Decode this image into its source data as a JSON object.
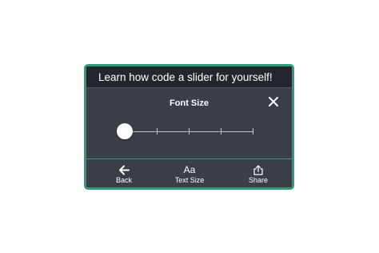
{
  "header": {
    "title": "Learn how code a slider for yourself!"
  },
  "panel": {
    "title": "Font Size",
    "close_icon": "close-icon"
  },
  "slider": {
    "tick_count": 5,
    "selected_index": 0,
    "value_fraction": 0
  },
  "footer": {
    "buttons": [
      {
        "label": "Back",
        "icon": "arrow-left-icon"
      },
      {
        "label": "Text Size",
        "icon": "text-size-icon",
        "icon_text": "Aa"
      },
      {
        "label": "Share",
        "icon": "share-icon"
      }
    ]
  },
  "colors": {
    "accent_border": "#2f9a73",
    "panel_bg": "#3a3e46",
    "header_bg": "#23262c"
  }
}
